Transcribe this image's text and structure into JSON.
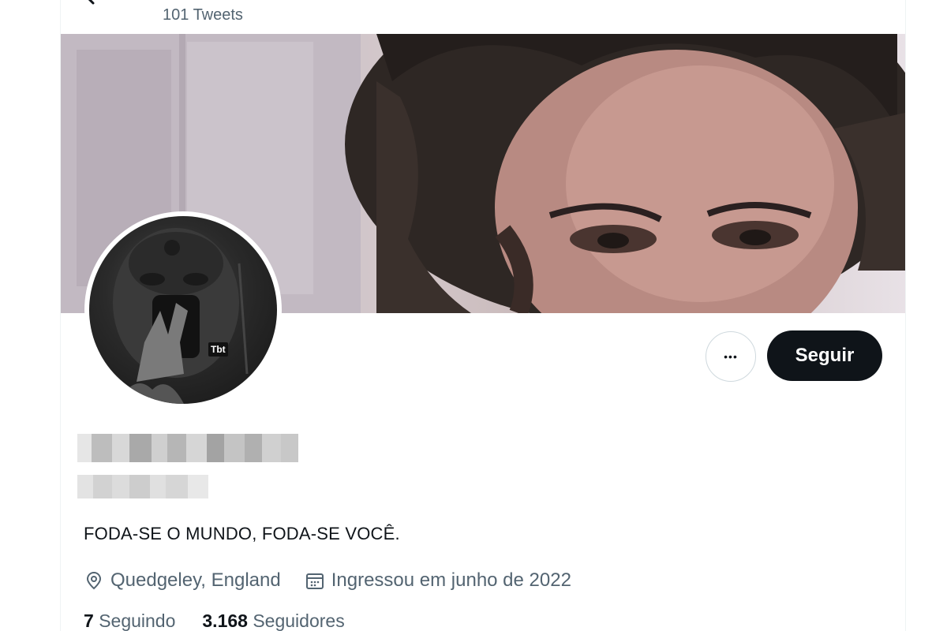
{
  "header": {
    "tweet_count": "101 Tweets"
  },
  "profile": {
    "avatar_badge": "Tbt",
    "bio": "FODA-SE O MUNDO, FODA-SE VOCÊ.",
    "location": "Quedgeley, England",
    "joined": "Ingressou em junho de 2022",
    "following_count": "7",
    "following_label": "Seguindo",
    "followers_count": "3.168",
    "followers_label": "Seguidores"
  },
  "actions": {
    "follow_label": "Seguir",
    "more_label": "•••"
  },
  "icons": {
    "back": "arrow-left-icon",
    "location": "map-pin-icon",
    "calendar": "calendar-icon"
  },
  "colors": {
    "primary_text": "#0f1419",
    "secondary_text": "#536471",
    "follow_bg": "#0f1419",
    "border": "#cfd9de"
  }
}
